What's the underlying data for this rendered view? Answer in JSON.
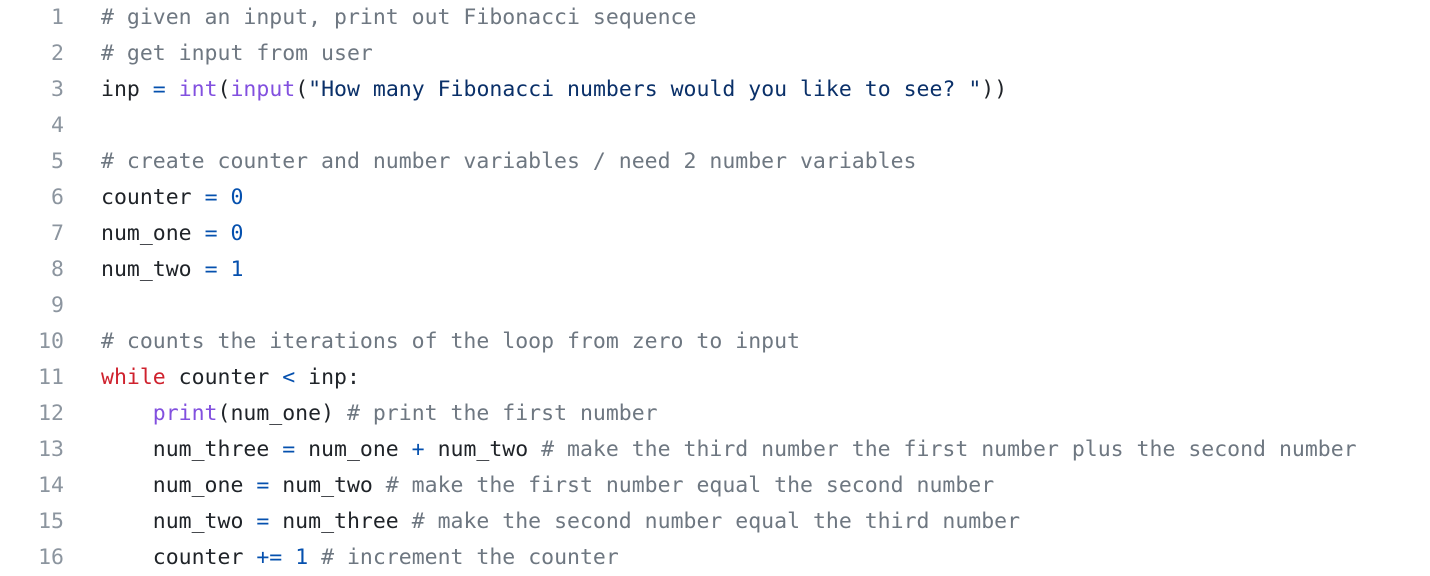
{
  "editor": {
    "colors": {
      "background": "#ffffff",
      "line_number": "#8c959f",
      "comment": "#6e7781",
      "keyword": "#cf222e",
      "builtin": "#8250df",
      "string": "#0a3069",
      "number": "#0550ae",
      "operator": "#0550ae",
      "plain": "#1f2328"
    },
    "lines": [
      {
        "number": "1",
        "tokens": [
          {
            "t": "comment",
            "v": "# given an input, print out Fibonacci sequence"
          }
        ]
      },
      {
        "number": "2",
        "tokens": [
          {
            "t": "comment",
            "v": "# get input from user"
          }
        ]
      },
      {
        "number": "3",
        "tokens": [
          {
            "t": "plain",
            "v": "inp "
          },
          {
            "t": "operator",
            "v": "="
          },
          {
            "t": "plain",
            "v": " "
          },
          {
            "t": "builtin",
            "v": "int"
          },
          {
            "t": "plain",
            "v": "("
          },
          {
            "t": "builtin",
            "v": "input"
          },
          {
            "t": "plain",
            "v": "("
          },
          {
            "t": "string",
            "v": "\"How many Fibonacci numbers would you like to see? \""
          },
          {
            "t": "plain",
            "v": "))"
          }
        ]
      },
      {
        "number": "4",
        "tokens": []
      },
      {
        "number": "5",
        "tokens": [
          {
            "t": "comment",
            "v": "# create counter and number variables / need 2 number variables"
          }
        ]
      },
      {
        "number": "6",
        "tokens": [
          {
            "t": "plain",
            "v": "counter "
          },
          {
            "t": "operator",
            "v": "="
          },
          {
            "t": "plain",
            "v": " "
          },
          {
            "t": "number",
            "v": "0"
          }
        ]
      },
      {
        "number": "7",
        "tokens": [
          {
            "t": "plain",
            "v": "num_one "
          },
          {
            "t": "operator",
            "v": "="
          },
          {
            "t": "plain",
            "v": " "
          },
          {
            "t": "number",
            "v": "0"
          }
        ]
      },
      {
        "number": "8",
        "tokens": [
          {
            "t": "plain",
            "v": "num_two "
          },
          {
            "t": "operator",
            "v": "="
          },
          {
            "t": "plain",
            "v": " "
          },
          {
            "t": "number",
            "v": "1"
          }
        ]
      },
      {
        "number": "9",
        "tokens": []
      },
      {
        "number": "10",
        "tokens": [
          {
            "t": "comment",
            "v": "# counts the iterations of the loop from zero to input"
          }
        ]
      },
      {
        "number": "11",
        "tokens": [
          {
            "t": "keyword",
            "v": "while"
          },
          {
            "t": "plain",
            "v": " counter "
          },
          {
            "t": "operator",
            "v": "<"
          },
          {
            "t": "plain",
            "v": " inp:"
          }
        ]
      },
      {
        "number": "12",
        "tokens": [
          {
            "t": "plain",
            "v": "    "
          },
          {
            "t": "builtin",
            "v": "print"
          },
          {
            "t": "plain",
            "v": "(num_one) "
          },
          {
            "t": "comment",
            "v": "# print the first number"
          }
        ]
      },
      {
        "number": "13",
        "tokens": [
          {
            "t": "plain",
            "v": "    num_three "
          },
          {
            "t": "operator",
            "v": "="
          },
          {
            "t": "plain",
            "v": " num_one "
          },
          {
            "t": "operator",
            "v": "+"
          },
          {
            "t": "plain",
            "v": " num_two "
          },
          {
            "t": "comment",
            "v": "# make the third number the first number plus the second number"
          }
        ]
      },
      {
        "number": "14",
        "tokens": [
          {
            "t": "plain",
            "v": "    num_one "
          },
          {
            "t": "operator",
            "v": "="
          },
          {
            "t": "plain",
            "v": " num_two "
          },
          {
            "t": "comment",
            "v": "# make the first number equal the second number"
          }
        ]
      },
      {
        "number": "15",
        "tokens": [
          {
            "t": "plain",
            "v": "    num_two "
          },
          {
            "t": "operator",
            "v": "="
          },
          {
            "t": "plain",
            "v": " num_three "
          },
          {
            "t": "comment",
            "v": "# make the second number equal the third number"
          }
        ]
      },
      {
        "number": "16",
        "tokens": [
          {
            "t": "plain",
            "v": "    counter "
          },
          {
            "t": "operator",
            "v": "+="
          },
          {
            "t": "plain",
            "v": " "
          },
          {
            "t": "number",
            "v": "1"
          },
          {
            "t": "plain",
            "v": " "
          },
          {
            "t": "comment",
            "v": "# increment the counter"
          }
        ]
      }
    ]
  }
}
